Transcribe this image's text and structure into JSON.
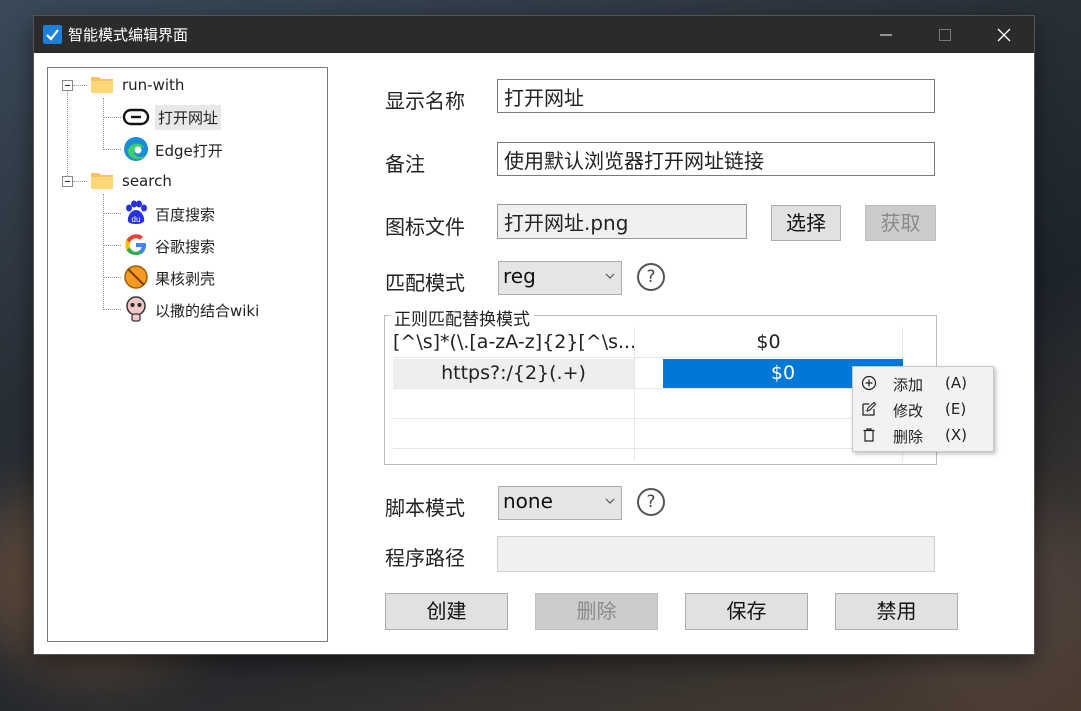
{
  "window": {
    "title": "智能模式编辑界面"
  },
  "tree": {
    "groups": [
      {
        "label": "run-with",
        "icon": "folder-icon",
        "children": [
          {
            "label": "打开网址",
            "icon": "link-icon",
            "selected": true
          },
          {
            "label": "Edge打开",
            "icon": "edge-icon",
            "selected": false
          }
        ]
      },
      {
        "label": "search",
        "icon": "folder-icon",
        "children": [
          {
            "label": "百度搜索",
            "icon": "baidu-icon",
            "selected": false
          },
          {
            "label": "谷歌搜索",
            "icon": "google-icon",
            "selected": false
          },
          {
            "label": "果核剥壳",
            "icon": "orange-ball-icon",
            "selected": false
          },
          {
            "label": "以撒的结合wiki",
            "icon": "isaac-icon",
            "selected": false
          }
        ]
      }
    ]
  },
  "form": {
    "display_name_label": "显示名称",
    "display_name_value": "打开网址",
    "note_label": "备注",
    "note_value": "使用默认浏览器打开网址链接",
    "icon_file_label": "图标文件",
    "icon_file_value": "打开网址.png",
    "choose_button": "选择",
    "fetch_button": "获取",
    "match_mode_label": "匹配模式",
    "match_mode_value": "reg",
    "help_mark": "?",
    "regex_group_title": "正则匹配替换模式",
    "script_mode_label": "脚本模式",
    "script_mode_value": "none",
    "program_path_label": "程序路径",
    "program_path_value": ""
  },
  "regex_table": {
    "rows": [
      {
        "pattern": "[^\\s]*(\\.[a-zA-z]{2}[^\\s...",
        "replace": "$0"
      },
      {
        "pattern": "https?:/{2}(.+)",
        "replace": "$0"
      }
    ]
  },
  "context_menu": {
    "items": [
      {
        "label": "添加",
        "key": "(A)",
        "icon": "plus-circle-icon"
      },
      {
        "label": "修改",
        "key": "(E)",
        "icon": "edit-icon"
      },
      {
        "label": "删除",
        "key": "(X)",
        "icon": "trash-icon"
      }
    ]
  },
  "buttons": {
    "create": "创建",
    "delete": "删除",
    "save": "保存",
    "disable": "禁用"
  },
  "colors": {
    "accent": "#0078d7",
    "titlebar": "#2b2b2b"
  }
}
